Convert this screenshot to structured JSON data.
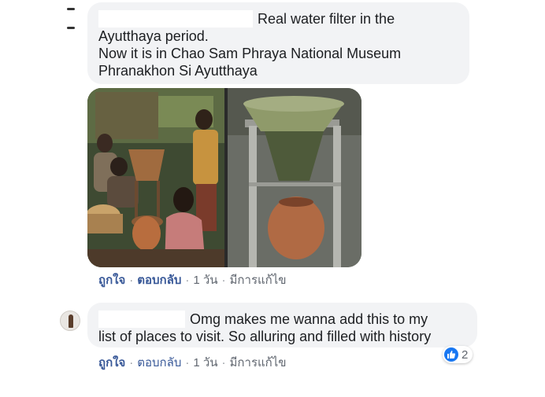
{
  "comment1": {
    "text_lines": [
      "Real water filter in the",
      "Ayutthaya period.",
      "Now it is in Chao Sam Phraya National Museum",
      "Phranakhon Si Ayutthaya"
    ],
    "actions": {
      "like": "ถูกใจ",
      "reply": "ตอบกลับ",
      "time": "1 วัน",
      "edited": "มีการแก้ไข"
    }
  },
  "comment2": {
    "text_lines": [
      "Omg makes me wanna add this to my",
      "list of places to visit. So alluring and filled with history"
    ],
    "actions": {
      "like": "ถูกใจ",
      "reply": "ตอบกลับ",
      "time": "1 วัน",
      "edited": "มีการแก้ไข"
    },
    "reactions": {
      "icon": "like-icon",
      "count": "2"
    }
  },
  "separator": "·",
  "colors": {
    "bubble": "#f2f3f5",
    "link": "#385898",
    "meta": "#616770",
    "like": "#1877f2"
  }
}
